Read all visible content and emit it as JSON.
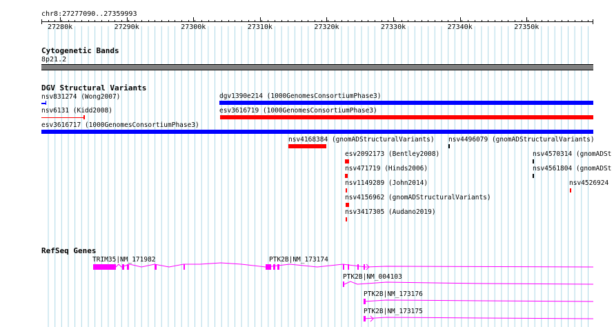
{
  "ruler": {
    "region": "chr8:27277090..27359993",
    "ticks": [
      "27280k",
      "27290k",
      "27300k",
      "27310k",
      "27320k",
      "27330k",
      "27340k",
      "27350k"
    ]
  },
  "cytoband": {
    "title": "Cytogenetic Bands",
    "band": "8p21.2"
  },
  "dgv": {
    "title": "DGV Structural Variants",
    "features": [
      {
        "label": "nsv831274 (Wong2007)",
        "color": "#0000ff"
      },
      {
        "label": "dgv1390e214 (1000GenomesConsortiumPhase3)",
        "color": "#0000ff"
      },
      {
        "label": "nsv6131 (Kidd2008)",
        "color": "#ff0000"
      },
      {
        "label": "esv3616719 (1000GenomesConsortiumPhase3)",
        "color": "#ff0000"
      },
      {
        "label": "esv3616717 (1000GenomesConsortiumPhase3)",
        "color": "#0000ff"
      },
      {
        "label": "nsv4168384 (gnomADStructuralVariants)",
        "color": "#ff0000"
      },
      {
        "label": "nsv4496079 (gnomADStructuralVariants)",
        "color": "#000000"
      },
      {
        "label": "esv2092173 (Bentley2008)",
        "color": "#ff0000"
      },
      {
        "label": "nsv4570314 (gnomADSt",
        "color": "#000000"
      },
      {
        "label": "nsv471719 (Hinds2006)",
        "color": "#ff0000"
      },
      {
        "label": "nsv4561804 (gnomADSt",
        "color": "#000000"
      },
      {
        "label": "nsv1149289 (John2014)",
        "color": "#ff0000"
      },
      {
        "label": "nsv4526924",
        "color": "#ff0000"
      },
      {
        "label": "nsv4156962 (gnomADStructuralVariants)",
        "color": "#ff0000"
      },
      {
        "label": "nsv3417305 (Audano2019)",
        "color": "#ff0000"
      }
    ]
  },
  "refseq": {
    "title": "RefSeq Genes",
    "color": "#ff00ff",
    "genes": [
      {
        "label": "TRIM35|NM_171982"
      },
      {
        "label": "PTK2B|NM_173174"
      },
      {
        "label": "PTK2B|NM_004103"
      },
      {
        "label": "PTK2B|NM_173176"
      },
      {
        "label": "PTK2B|NM_173175"
      }
    ]
  },
  "colors": {
    "grid": "#add8e6",
    "cytoband": "#808080"
  }
}
